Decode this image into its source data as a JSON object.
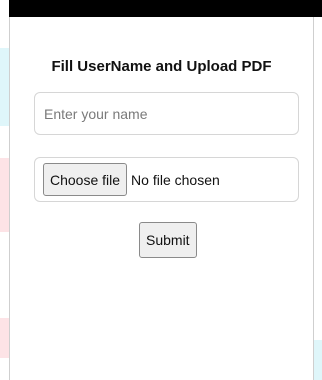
{
  "form": {
    "title": "Fill UserName and Upload PDF",
    "name_placeholder": "Enter your name",
    "choose_file_label": "Choose file",
    "file_status": "No file chosen",
    "submit_label": "Submit"
  },
  "colors": {
    "header_bar": "#000000",
    "input_border": "#d6d6d6",
    "button_bg": "#efefef"
  }
}
